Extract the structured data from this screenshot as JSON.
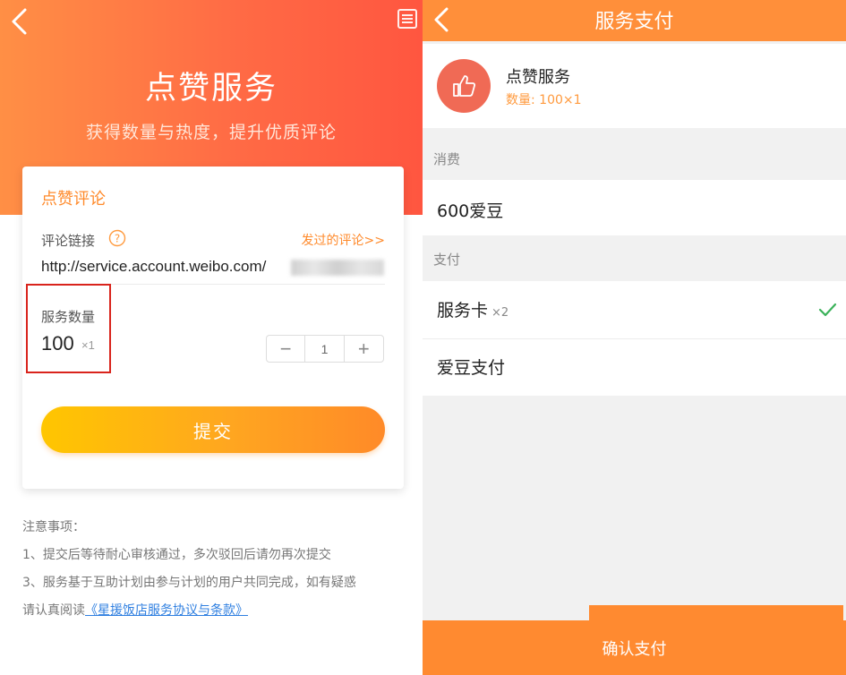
{
  "left": {
    "hero": {
      "title": "点赞服务",
      "subtitle": "获得数量与热度，提升优质评论"
    },
    "card": {
      "title": "点赞评论",
      "link_label": "评论链接",
      "history_link": "发过的评论>>",
      "url": "http://service.account.weibo.com/",
      "quantity_label": "服务数量",
      "quantity_value": "100",
      "quantity_multiplier": "×1",
      "stepper": {
        "minus": "−",
        "value": "1",
        "plus": "+"
      },
      "submit_label": "提交"
    },
    "notes": {
      "title": "注意事项：",
      "items": [
        "1、提交后等待耐心审核通过，多次驳回后请勿再次提交",
        "3、服务基于互助计划由参与计划的用户共同完成，如有疑惑"
      ],
      "read_prefix": "请认真阅读",
      "agreement_link": "《星援饭店服务协议与条款》"
    }
  },
  "right": {
    "title": "服务支付",
    "service": {
      "name": "点赞服务",
      "quantity": "数量: 100×1"
    },
    "consume_label": "消费",
    "consume_amount": "600爱豆",
    "pay_label": "支付",
    "methods": [
      {
        "label": "服务卡",
        "multiplier": "×2",
        "selected": true
      },
      {
        "label": "爱豆支付",
        "multiplier": "",
        "selected": false
      }
    ],
    "confirm_label": "确认支付"
  },
  "colors": {
    "accent_orange": "#ff8f3a",
    "hero_red": "#ff5640",
    "link_blue": "#2f7fe0",
    "check_green": "#3bb25a",
    "highlight_red": "#d9241c"
  }
}
